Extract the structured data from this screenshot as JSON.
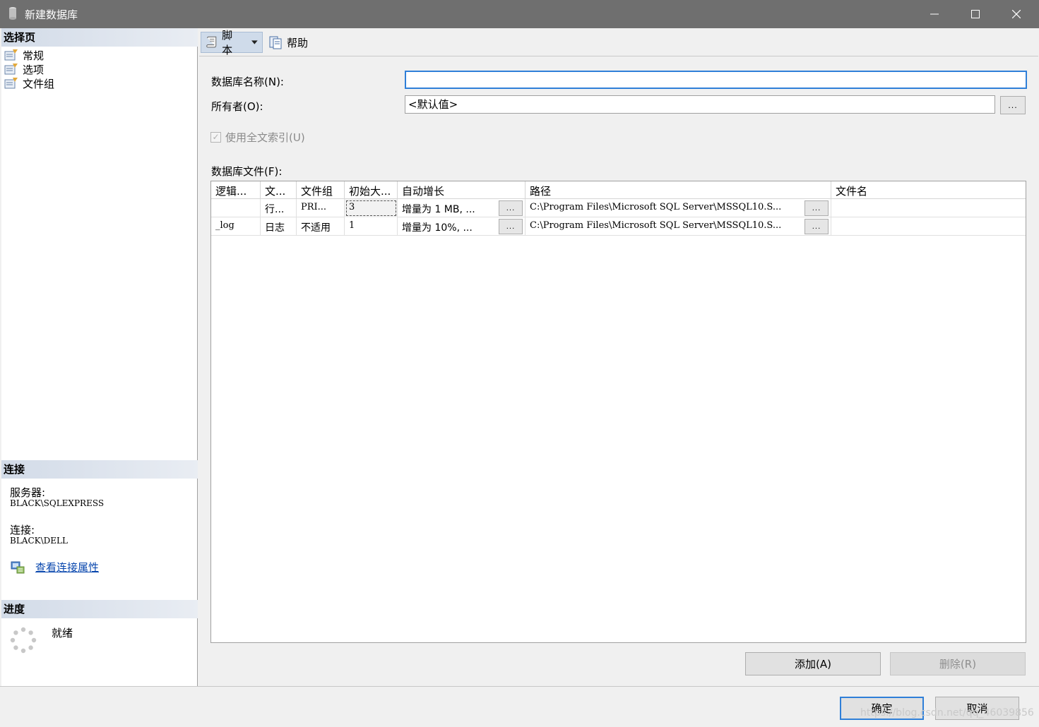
{
  "window": {
    "title": "新建数据库",
    "minimize": "—",
    "maximize": "☐",
    "close": "✕"
  },
  "left": {
    "select_page_header": "选择页",
    "pages": [
      {
        "label": "常规"
      },
      {
        "label": "选项"
      },
      {
        "label": "文件组"
      }
    ],
    "connection_header": "连接",
    "server_label": "服务器:",
    "server_value": "BLACK\\SQLEXPRESS",
    "connection_label": "连接:",
    "connection_value": "BLACK\\DELL",
    "view_properties_link": "查看连接属性",
    "progress_header": "进度",
    "progress_status": "就绪"
  },
  "toolbar": {
    "script_label": "脚本",
    "help_label": "帮助"
  },
  "form": {
    "db_name_label": "数据库名称(N):",
    "db_name_value": "",
    "owner_label": "所有者(O):",
    "owner_value": "<默认值>",
    "browse_label": "...",
    "fulltext_label": "使用全文索引(U)",
    "fulltext_checked": true,
    "files_label": "数据库文件(F):"
  },
  "grid": {
    "columns": [
      "逻辑...",
      "文...",
      "文件组",
      "初始大...",
      "自动增长",
      "路径",
      "文件名"
    ],
    "rows": [
      {
        "logical": "",
        "type": "行...",
        "filegroup": "PRI...",
        "size": "3",
        "growth": "增量为 1 MB, ...",
        "path": "C:\\Program Files\\Microsoft SQL Server\\MSSQL10.S...",
        "filename": ""
      },
      {
        "logical": "_log",
        "type": "日志",
        "filegroup": "不适用",
        "size": "1",
        "growth": "增量为 10%, ...",
        "path": "C:\\Program Files\\Microsoft SQL Server\\MSSQL10.S...",
        "filename": ""
      }
    ],
    "cell_button": "..."
  },
  "buttons": {
    "add": "添加(A)",
    "remove": "删除(R)",
    "ok": "确定",
    "cancel": "取消"
  },
  "watermark": "https://blog.csdn.net/qq_46039856"
}
